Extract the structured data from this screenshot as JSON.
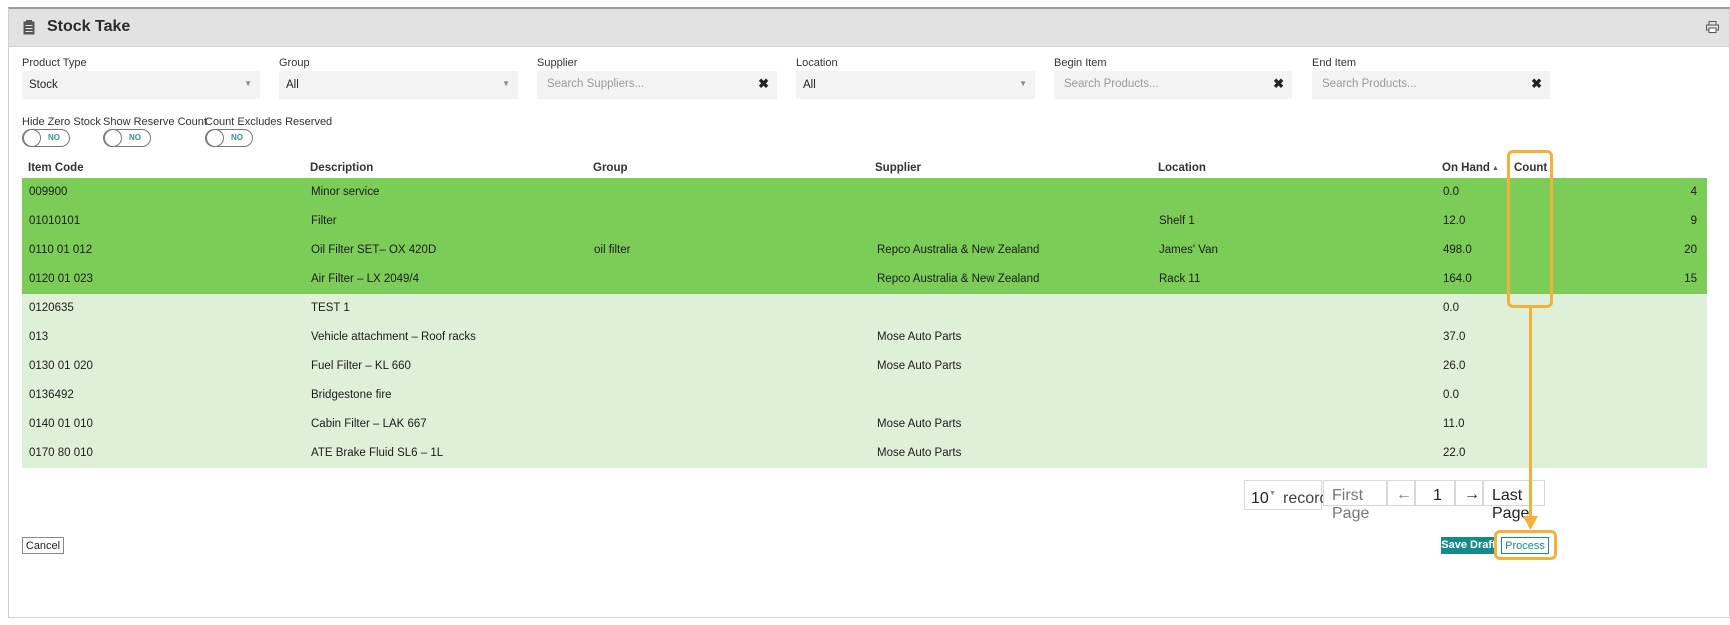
{
  "header": {
    "title": "Stock Take",
    "title_icon": "clipboard-icon",
    "print_icon": "print-icon"
  },
  "filters": {
    "product_type": {
      "label": "Product Type",
      "value": "Stock"
    },
    "group": {
      "label": "Group",
      "value": "All"
    },
    "supplier": {
      "label": "Supplier",
      "placeholder": "Search Suppliers..."
    },
    "location": {
      "label": "Location",
      "value": "All"
    },
    "begin_item": {
      "label": "Begin Item",
      "placeholder": "Search Products..."
    },
    "end_item": {
      "label": "End Item",
      "placeholder": "Search Products..."
    }
  },
  "toggles": [
    {
      "label": "Hide Zero Stock",
      "state": "NO"
    },
    {
      "label": "Show Reserve Count",
      "state": "NO"
    },
    {
      "label": "Count Excludes Reserved",
      "state": "NO"
    }
  ],
  "table": {
    "columns": {
      "item_code": "Item Code",
      "description": "Description",
      "group": "Group",
      "supplier": "Supplier",
      "location": "Location",
      "on_hand": "On Hand",
      "count": "Count"
    },
    "rows": [
      {
        "item_code": "009900",
        "description": "Minor service",
        "group": "",
        "supplier": "",
        "location": "",
        "on_hand": "0.0",
        "count": "4"
      },
      {
        "item_code": "01010101",
        "description": "Filter",
        "group": "",
        "supplier": "",
        "location": "Shelf 1",
        "on_hand": "12.0",
        "count": "9"
      },
      {
        "item_code": "0110 01 012",
        "description": "Oil Filter SET– OX 420D",
        "group": "oil filter",
        "supplier": "Repco Australia & New Zealand",
        "location": "James' Van",
        "on_hand": "498.0",
        "count": "20"
      },
      {
        "item_code": "0120 01 023",
        "description": "Air Filter – LX 2049/4",
        "group": "",
        "supplier": "Repco Australia & New Zealand",
        "location": "Rack 11",
        "on_hand": "164.0",
        "count": "15"
      },
      {
        "item_code": "0120635",
        "description": "TEST 1",
        "group": "",
        "supplier": "",
        "location": "",
        "on_hand": "0.0",
        "count": ""
      },
      {
        "item_code": "013",
        "description": "Vehicle attachment – Roof racks",
        "group": "",
        "supplier": "Mose Auto Parts",
        "location": "",
        "on_hand": "37.0",
        "count": ""
      },
      {
        "item_code": "0130 01 020",
        "description": "Fuel Filter – KL 660",
        "group": "",
        "supplier": "Mose Auto Parts",
        "location": "",
        "on_hand": "26.0",
        "count": ""
      },
      {
        "item_code": "0136492",
        "description": "Bridgestone fire",
        "group": "",
        "supplier": "",
        "location": "",
        "on_hand": "0.0",
        "count": ""
      },
      {
        "item_code": "0140 01 010",
        "description": "Cabin Filter – LAK 667",
        "group": "",
        "supplier": "Mose Auto Parts",
        "location": "",
        "on_hand": "11.0",
        "count": ""
      },
      {
        "item_code": "0170 80 010",
        "description": "ATE Brake Fluid SL6 – 1L",
        "group": "",
        "supplier": "Mose Auto Parts",
        "location": "",
        "on_hand": "22.0",
        "count": ""
      }
    ]
  },
  "pager": {
    "page_size": "10",
    "records_label": "records",
    "first_page": "First Page",
    "prev": "←",
    "page": "1",
    "next": "→",
    "last_page": "Last Page"
  },
  "actions": {
    "cancel": "Cancel",
    "save_draft": "Save Draft",
    "process": "Process"
  },
  "colors": {
    "counted_row": "#7ccd58",
    "uncounted_row": "#dff0d8",
    "highlight": "#f3b03a",
    "save_draft_bg": "#168a8a",
    "process_text": "#168a8a"
  }
}
